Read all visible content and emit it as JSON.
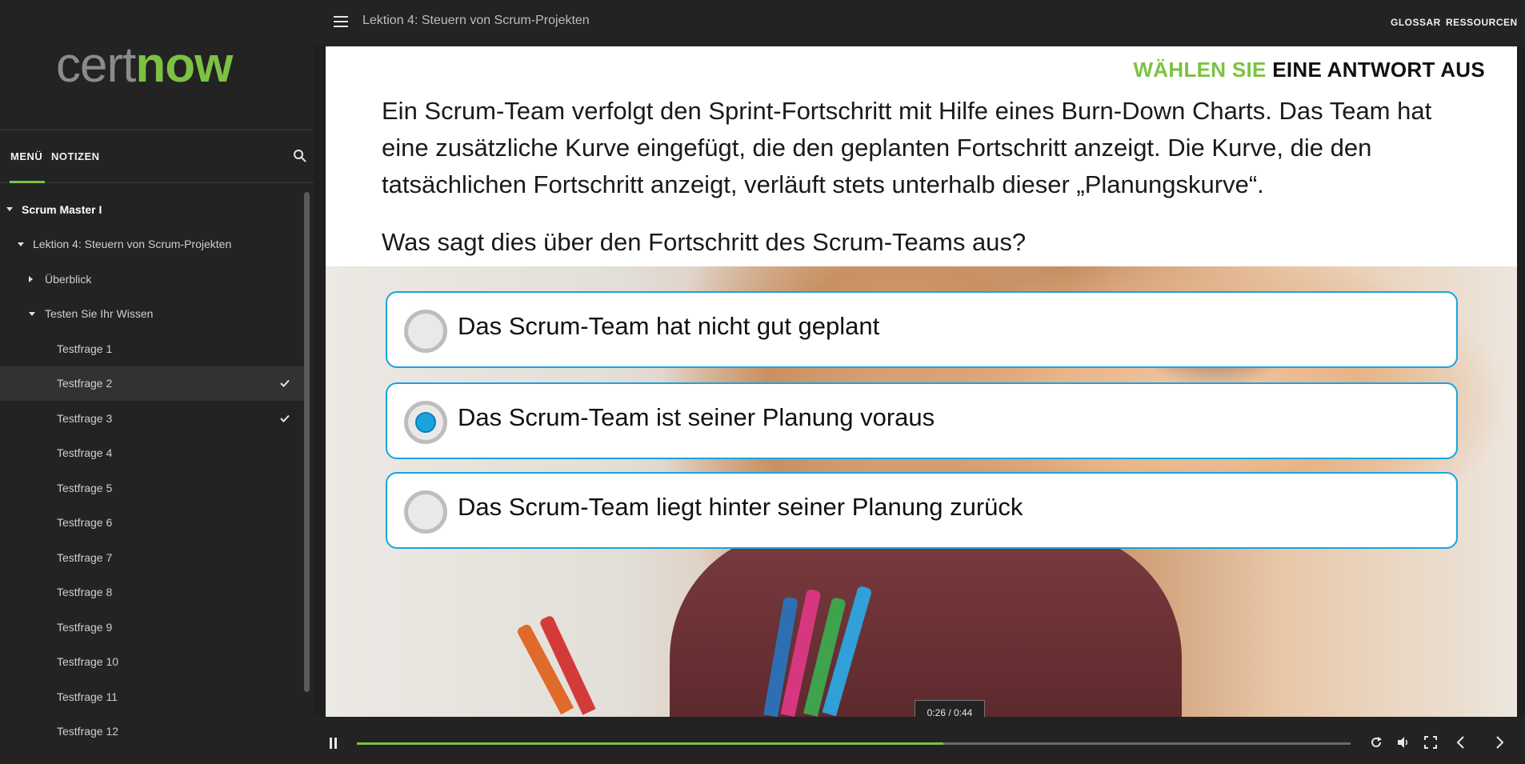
{
  "brand": {
    "logo_part1": "cert",
    "logo_part2": "now",
    "accent": "#7cc242"
  },
  "sidebar": {
    "tabs": [
      {
        "label": "MENÜ",
        "active": true
      },
      {
        "label": "NOTIZEN",
        "active": false
      }
    ],
    "search_icon": "search-icon",
    "tree": [
      {
        "label": "Scrum Master I",
        "level": 0,
        "expanded": true,
        "bold": true
      },
      {
        "label": "Lektion 4: Steuern von Scrum-Projekten",
        "level": 1,
        "expanded": true
      },
      {
        "label": "Überblick",
        "level": 2,
        "expanded": false
      },
      {
        "label": "Testen Sie Ihr Wissen",
        "level": 2,
        "expanded": true
      },
      {
        "label": "Testfrage 1",
        "level": 3
      },
      {
        "label": "Testfrage 2",
        "level": 3,
        "active": true,
        "completed": true
      },
      {
        "label": "Testfrage 3",
        "level": 3,
        "completed": true
      },
      {
        "label": "Testfrage 4",
        "level": 3
      },
      {
        "label": "Testfrage 5",
        "level": 3
      },
      {
        "label": "Testfrage 6",
        "level": 3
      },
      {
        "label": "Testfrage 7",
        "level": 3
      },
      {
        "label": "Testfrage 8",
        "level": 3
      },
      {
        "label": "Testfrage 9",
        "level": 3
      },
      {
        "label": "Testfrage 10",
        "level": 3
      },
      {
        "label": "Testfrage 11",
        "level": 3
      },
      {
        "label": "Testfrage 12",
        "level": 3
      }
    ]
  },
  "topbar": {
    "lesson_title": "Lektion 4: Steuern von Scrum-Projekten",
    "links": [
      "GLOSSAR",
      "RESSOURCEN"
    ]
  },
  "quiz": {
    "instruction_green": "WÄHLEN SIE",
    "instruction_dark": "EINE ANTWORT AUS",
    "question": "Ein Scrum-Team verfolgt den Sprint-Fortschritt mit Hilfe eines Burn-Down Charts. Das Team hat eine zusätzliche Kurve eingefügt, die den geplanten Fortschritt anzeigt. Die Kurve, die den tatsächlichen Fortschritt anzeigt, verläuft stets unterhalb dieser „Planungskurve“.",
    "question_2": "Was sagt dies über den Fortschritt des Scrum-Teams aus?",
    "answers": [
      {
        "label": "Das Scrum-Team hat nicht gut geplant",
        "selected": false
      },
      {
        "label": "Das Scrum-Team ist seiner Planung voraus",
        "selected": true
      },
      {
        "label": "Das Scrum-Team liegt hinter seiner Planung zurück",
        "selected": false
      }
    ],
    "answer_border_color": "#1aa3e0"
  },
  "player": {
    "timecode": "0:26 / 0:44",
    "progress": 0.59,
    "icons": [
      "replay-icon",
      "volume-icon",
      "fullscreen-icon",
      "prev-icon",
      "next-icon"
    ]
  }
}
